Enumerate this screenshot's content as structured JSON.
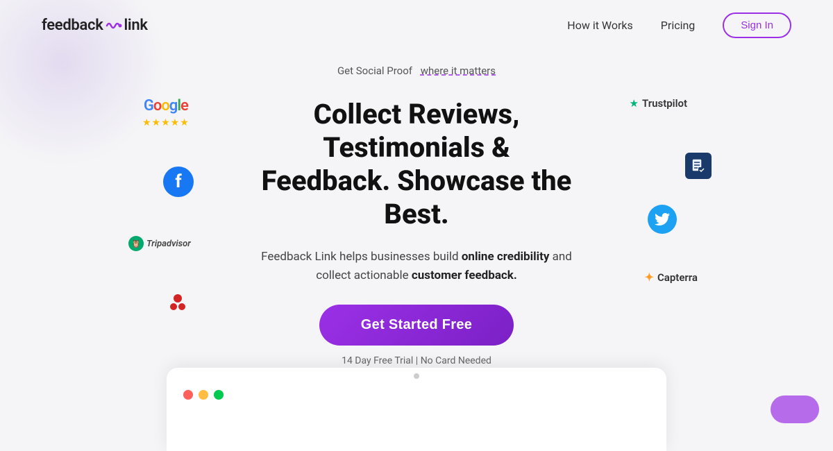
{
  "brand": {
    "name_feedback": "feedback",
    "name_link": "link",
    "logo_icon": "~"
  },
  "nav": {
    "how_it_works": "How it Works",
    "pricing": "Pricing",
    "sign_in": "Sign In"
  },
  "hero": {
    "subtitle_static": "Get Social Proof",
    "subtitle_link": "where it matters",
    "headline_line1": "Collect Reviews, Testimonials &",
    "headline_line2": "Feedback. Showcase the Best.",
    "body_part1": "Feedback Link helps businesses build",
    "body_bold1": "online credibility",
    "body_part2": "and collect actionable",
    "body_bold2": "customer feedback.",
    "cta_label": "Get Started Free",
    "trial_text": "14 Day Free Trial | No Card Needed"
  },
  "brands_left": [
    {
      "id": "google",
      "name": "Google",
      "stars": "★★★★★"
    },
    {
      "id": "facebook",
      "name": "f"
    },
    {
      "id": "tripadvisor",
      "name": "Tripadvisor"
    },
    {
      "id": "yelp",
      "name": "❧"
    }
  ],
  "brands_right": [
    {
      "id": "trustpilot",
      "name": "Trustpilot"
    },
    {
      "id": "reviews",
      "name": "📋"
    },
    {
      "id": "twitter",
      "name": "🐦"
    },
    {
      "id": "capterra",
      "name": "Capterra"
    }
  ],
  "bottom_card": {
    "dot_hint": "scroll indicator"
  }
}
